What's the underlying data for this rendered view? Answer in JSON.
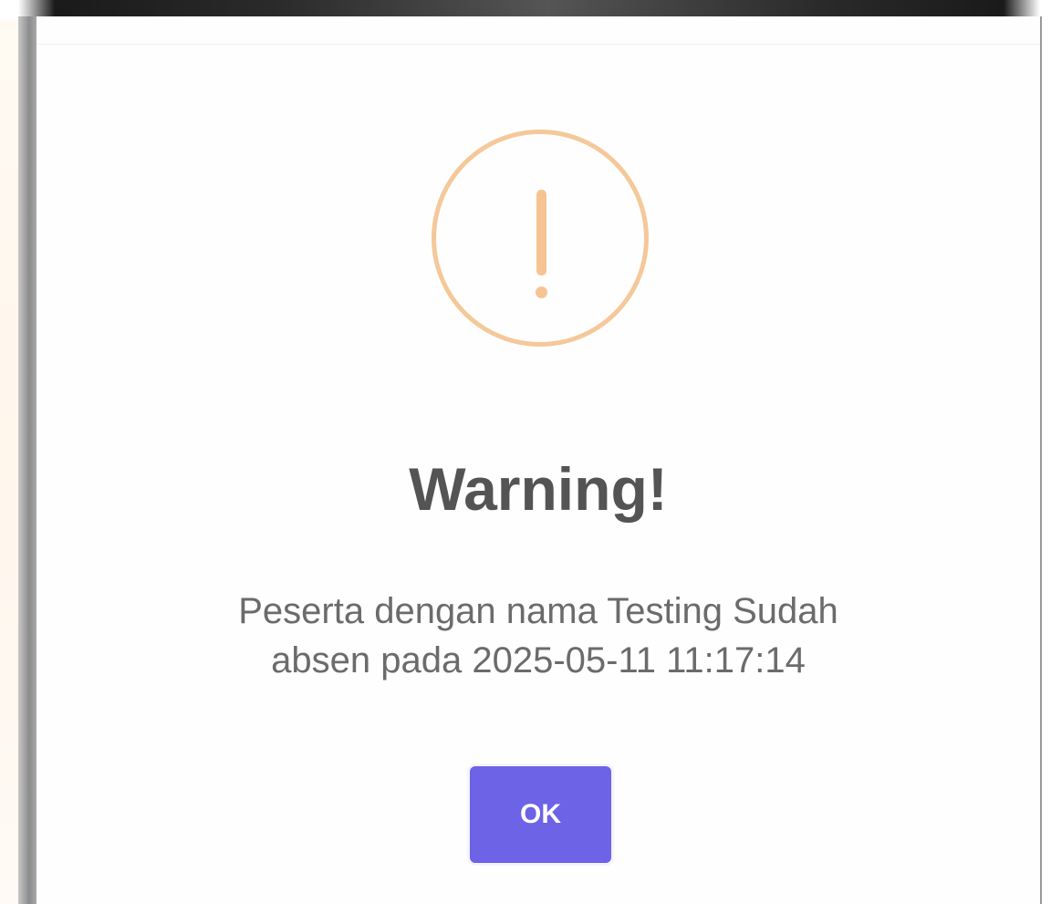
{
  "dialog": {
    "icon": "warning-icon",
    "title": "Warning!",
    "message_line1": "Peserta dengan nama Testing Sudah",
    "message_line2": "absen pada 2025-05-11 11:17:14",
    "confirm_label": "OK"
  },
  "colors": {
    "icon_accent": "#f8bb86",
    "confirm_button": "#6c63e6",
    "title_text": "#545454",
    "message_text": "#6b6b6b"
  }
}
